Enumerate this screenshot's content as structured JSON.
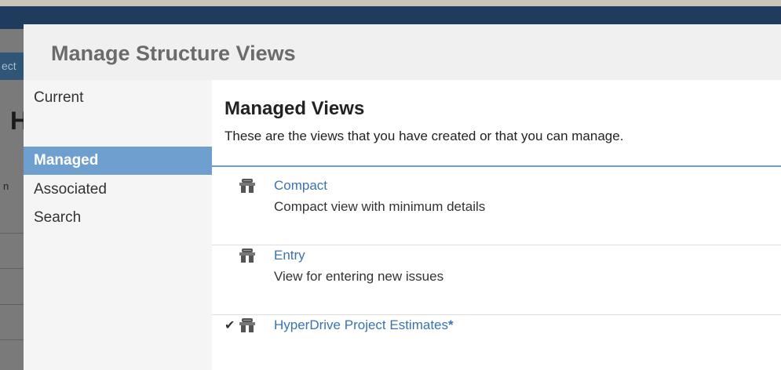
{
  "background": {
    "nav_text": "ect",
    "heading_letter": "H",
    "small_text": "n"
  },
  "dialog": {
    "title": "Manage Structure Views",
    "sidebar": {
      "items": [
        {
          "label": "Current",
          "active": false
        },
        {
          "label": "Managed",
          "active": true
        },
        {
          "label": "Associated",
          "active": false
        },
        {
          "label": "Search",
          "active": false
        }
      ]
    },
    "main": {
      "title": "Managed Views",
      "description": "These are the views that you have created or that you can manage.",
      "views": [
        {
          "name": "Compact",
          "description": "Compact view with minimum details",
          "selected": false,
          "modified_marker": ""
        },
        {
          "name": "Entry",
          "description": "View for entering new issues",
          "selected": false,
          "modified_marker": ""
        },
        {
          "name": "HyperDrive Project Estimates",
          "description": "",
          "selected": true,
          "modified_marker": "*"
        }
      ]
    }
  },
  "icons": {
    "view": "structure-view-icon",
    "check": "checkmark-icon"
  },
  "colors": {
    "accent": "#6f9fcf",
    "link": "#3b73af",
    "topbar": "#1f3c5e"
  }
}
